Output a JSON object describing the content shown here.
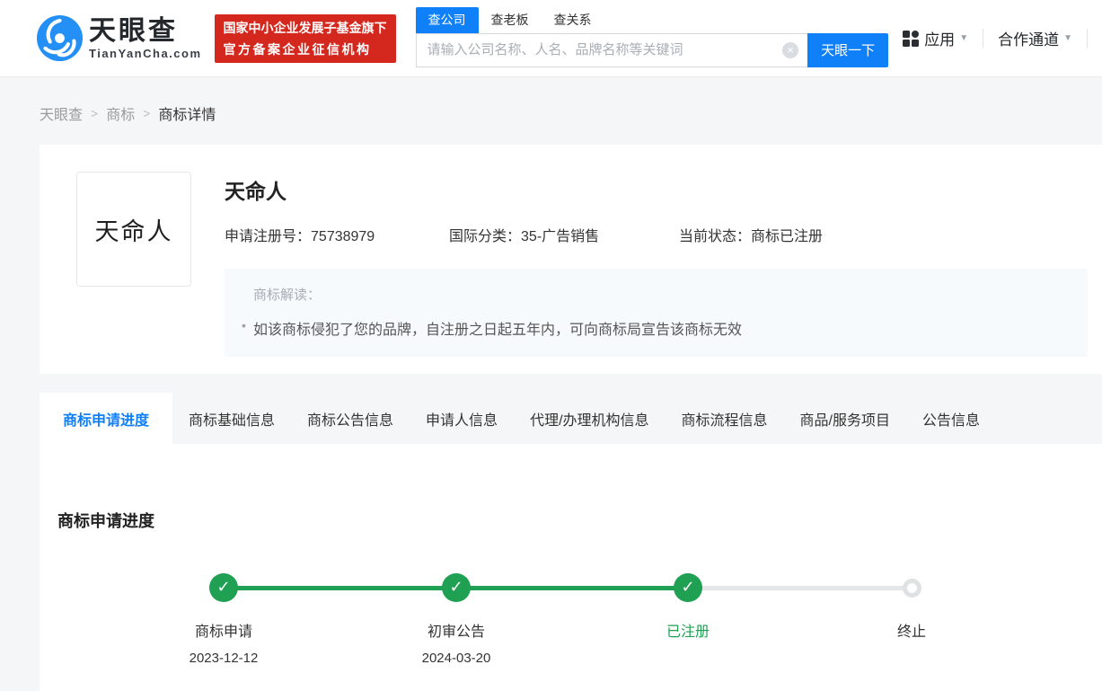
{
  "colors": {
    "accent_blue": "#1080F9",
    "logo_blue": "#2490F5",
    "badge_red": "#D4281E",
    "progress_green": "#1FA053",
    "pending_gray": "#E0E1E3",
    "page_bg": "#F5F6F7",
    "interp_bg": "#F7FAFC"
  },
  "icons": {
    "check": "✓",
    "clear": "×",
    "caret_down": "▼",
    "apps_grid": "grid-2x2"
  },
  "header": {
    "logo": {
      "name": "天眼查",
      "domain": "TianYanCha.com"
    },
    "badge": {
      "line1": "国家中小企业发展子基金旗下",
      "line2": "官方备案企业征信机构"
    },
    "search": {
      "tabs": [
        {
          "label": "查公司",
          "active": true
        },
        {
          "label": "查老板",
          "active": false
        },
        {
          "label": "查关系",
          "active": false
        }
      ],
      "placeholder": "请输入公司名称、人名、品牌名称等关键词",
      "button_label": "天眼一下"
    },
    "nav": {
      "apps": "应用",
      "partner": "合作通道"
    }
  },
  "breadcrumb": {
    "separator": ">",
    "items": [
      "天眼查",
      "商标",
      "商标详情"
    ]
  },
  "trademark": {
    "image_text": "天命人",
    "name": "天命人",
    "fields": [
      {
        "label": "申请注册号：",
        "value": "75738979"
      },
      {
        "label": "国际分类：",
        "value": "35-广告销售"
      },
      {
        "label": "当前状态：",
        "value": "商标已注册"
      }
    ],
    "interpretation": {
      "title": "商标解读：",
      "bullet": "•",
      "text": "如该商标侵犯了您的品牌，自注册之日起五年内，可向商标局宣告该商标无效"
    }
  },
  "section_tabs": [
    {
      "label": "商标申请进度",
      "active": true
    },
    {
      "label": "商标基础信息",
      "active": false
    },
    {
      "label": "商标公告信息",
      "active": false
    },
    {
      "label": "申请人信息",
      "active": false
    },
    {
      "label": "代理/办理机构信息",
      "active": false
    },
    {
      "label": "商标流程信息",
      "active": false
    },
    {
      "label": "商品/服务项目",
      "active": false
    },
    {
      "label": "公告信息",
      "active": false
    }
  ],
  "progress": {
    "heading": "商标申请进度",
    "steps": [
      {
        "label": "商标申请",
        "date": "2023-12-12",
        "state": "done"
      },
      {
        "label": "初审公告",
        "date": "2024-03-20",
        "state": "done"
      },
      {
        "label": "已注册",
        "date": "",
        "state": "current"
      },
      {
        "label": "终止",
        "date": "",
        "state": "pending"
      }
    ]
  }
}
